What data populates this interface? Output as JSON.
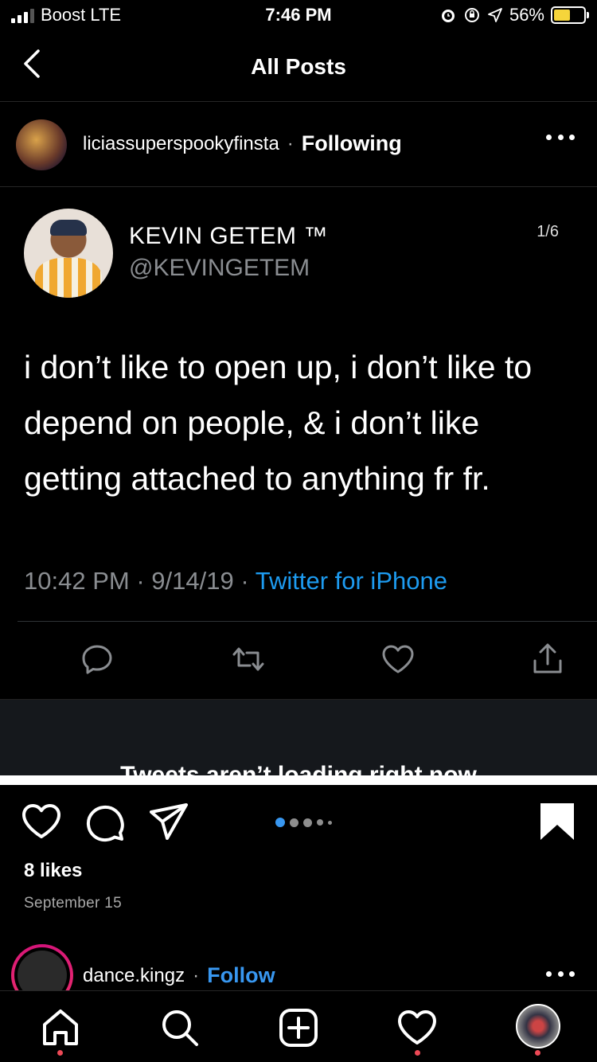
{
  "status_bar": {
    "carrier": "Boost LTE",
    "time": "7:46 PM",
    "battery_percent": "56%",
    "battery_level": 0.56,
    "battery_color": "#f6d53b",
    "icons": [
      "alarm-icon",
      "orientation-lock-icon",
      "location-icon"
    ]
  },
  "header": {
    "title": "All Posts",
    "back_icon": "chevron-left-icon"
  },
  "post": {
    "username": "liciassuperspookyfinsta",
    "separator": "·",
    "follow_state": "Following",
    "more_icon": "more-horizontal-icon"
  },
  "tweet": {
    "display_name": "KEVIN GETEM ™",
    "handle": "@KEVINGETEM",
    "counter": "1/6",
    "text": "i don’t like to open up, i don’t like to depend on people, & i don’t like getting attached to anything fr fr.",
    "time": "10:42 PM",
    "date": "9/14/19",
    "source": "Twitter for iPhone",
    "meta_separator": "·",
    "accent_color": "#1d9bf0",
    "actions": [
      "reply-icon",
      "retweet-icon",
      "like-icon",
      "share-icon"
    ]
  },
  "banner": {
    "message": "Tweets aren’t loading right now"
  },
  "post_actions": {
    "icons": [
      "heart-icon",
      "comment-icon",
      "send-icon",
      "bookmark-icon"
    ],
    "page_count": 5,
    "current_page": 1,
    "pager_active_color": "#3897f0"
  },
  "likes": "8 likes",
  "date": "September 15",
  "next_post": {
    "username": "dance.kingz",
    "separator": "·",
    "follow_label": "Follow",
    "follow_color": "#3897f0"
  },
  "tabbar": {
    "tabs": [
      "home-icon",
      "search-icon",
      "new-post-icon",
      "activity-icon",
      "profile-avatar"
    ],
    "notification_color": "#ed4956"
  }
}
